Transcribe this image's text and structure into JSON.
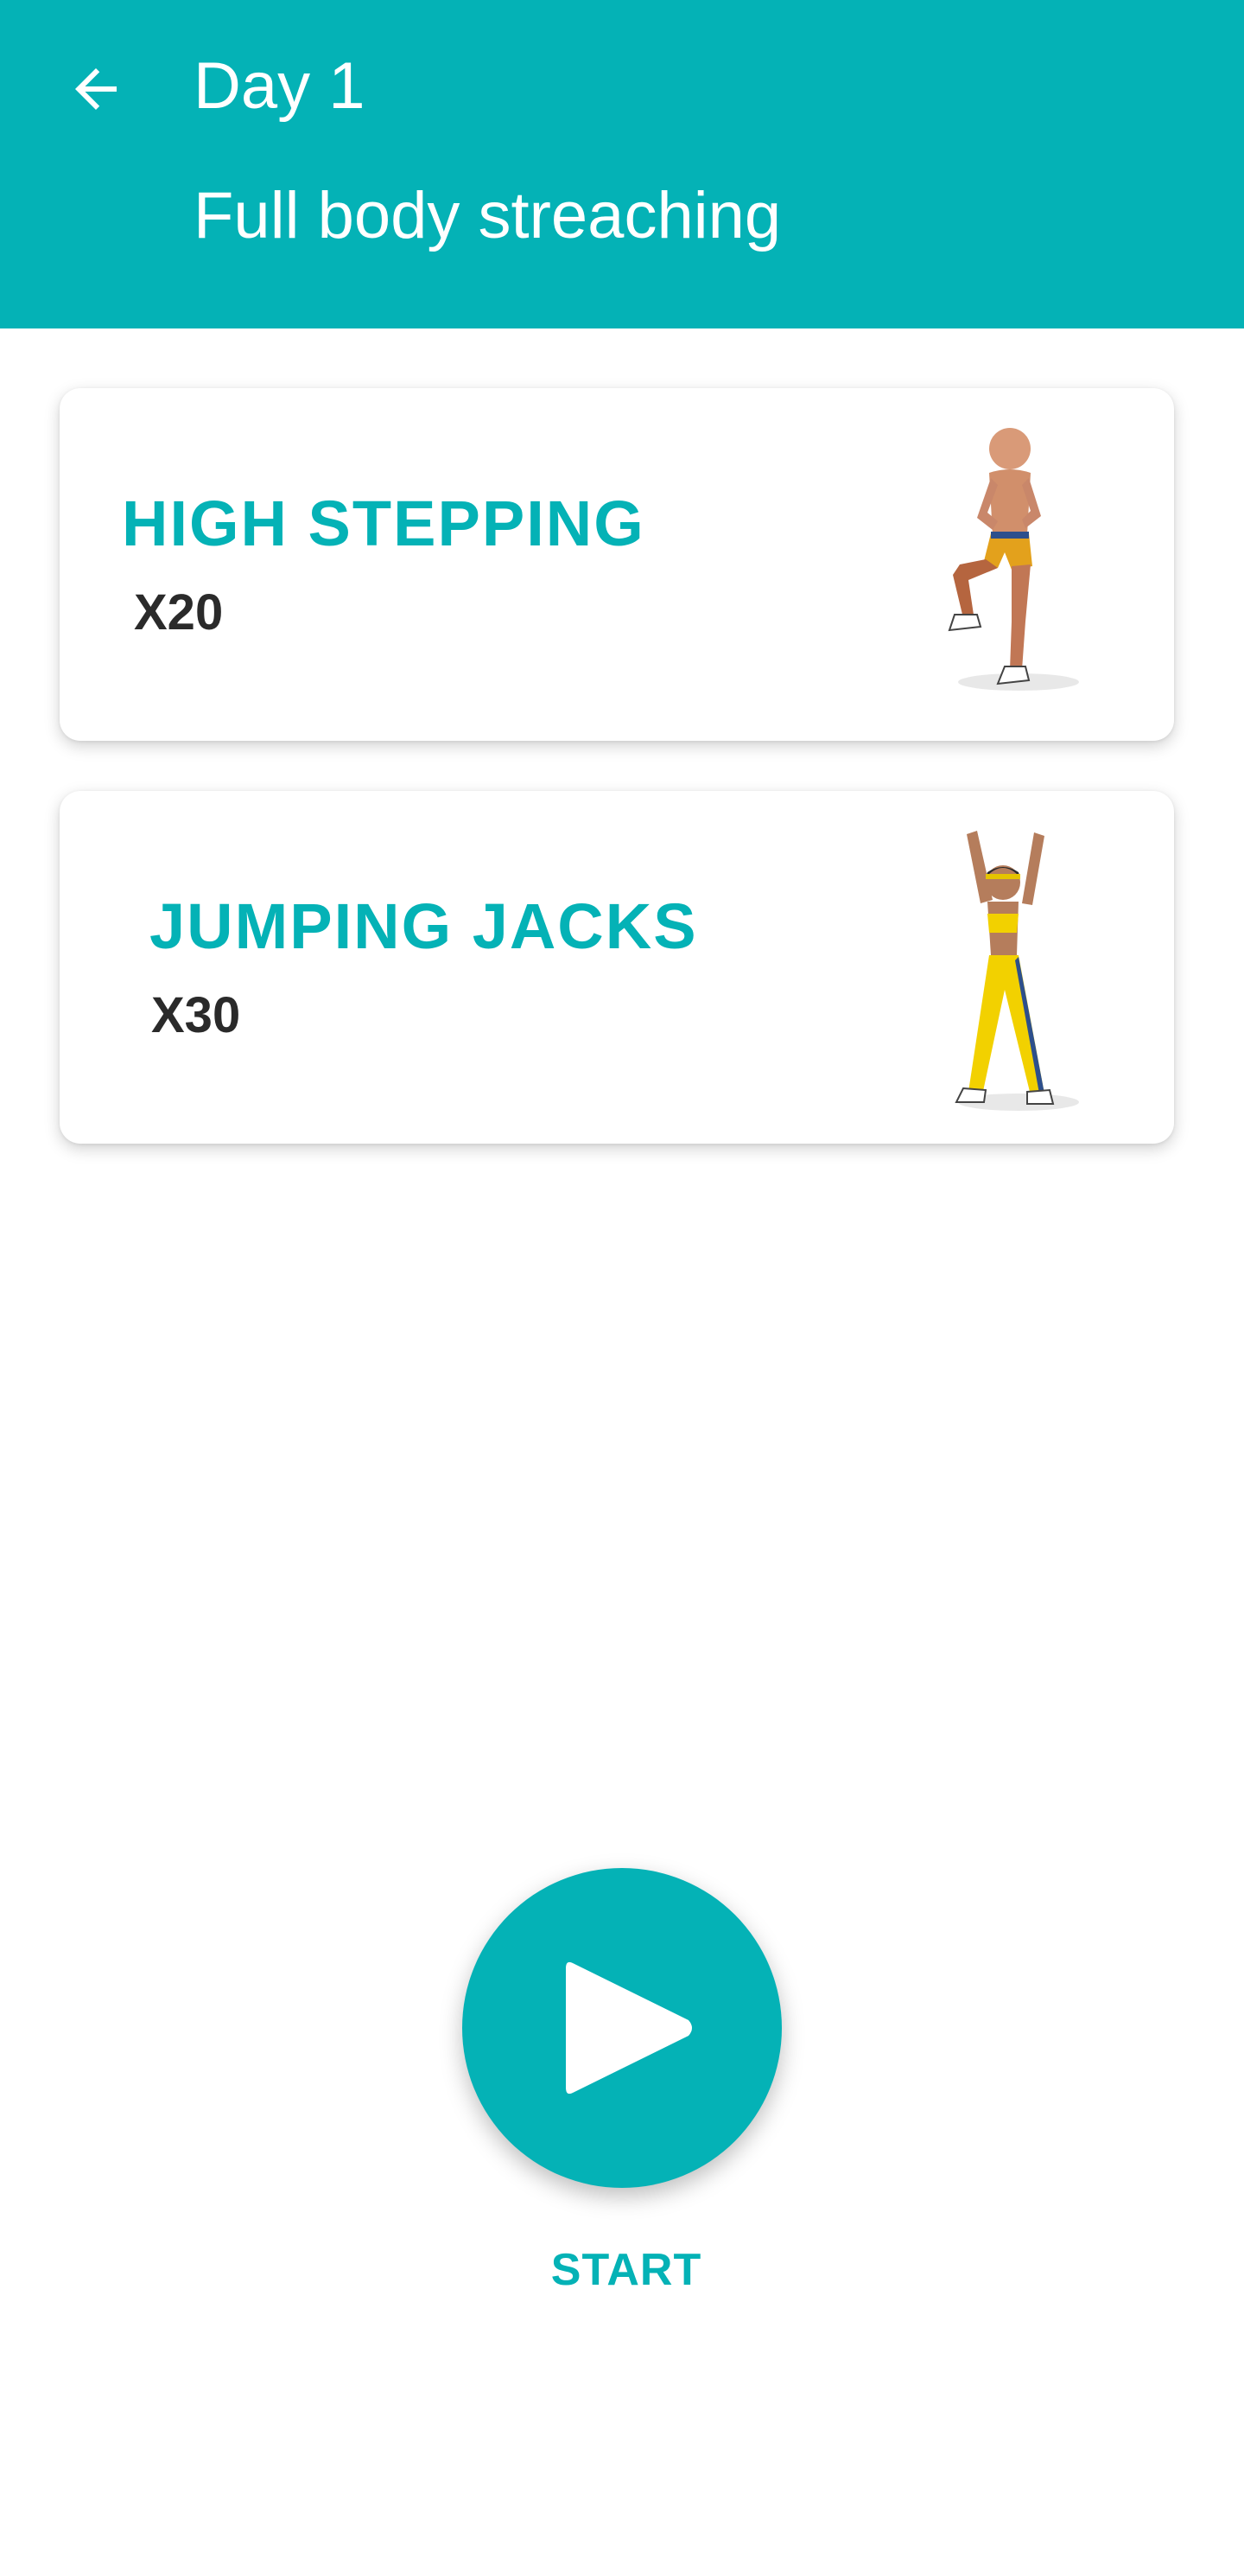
{
  "app_bar": {
    "back_icon": "arrow-left-icon",
    "title": "Day 1",
    "subtitle": "Full body streaching",
    "background_color": "#04b2b6"
  },
  "exercises": [
    {
      "name": "HIGH STEPPING",
      "reps": "X20",
      "illustration": "man-high-stepping-figure"
    },
    {
      "name": "JUMPING JACKS",
      "reps": "X30",
      "illustration": "woman-jumping-jacks-figure"
    }
  ],
  "start": {
    "icon": "play-icon",
    "label": "START"
  },
  "colors": {
    "accent": "#04b2b6",
    "text_dark": "#2a2a2a"
  }
}
